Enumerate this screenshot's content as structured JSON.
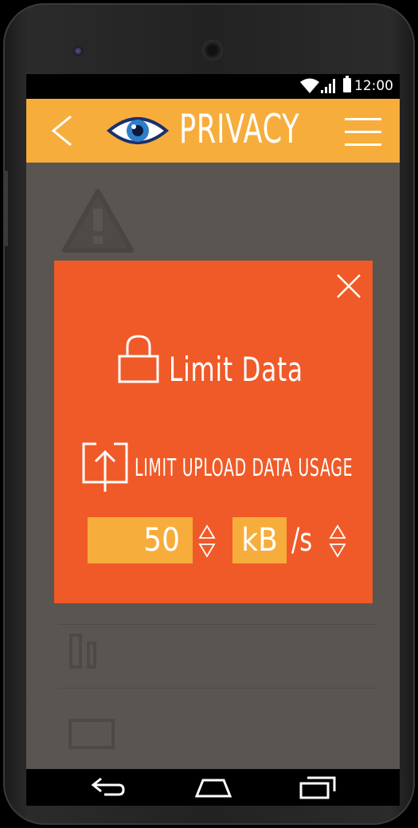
{
  "status_bar": {
    "time": "12:00",
    "icons": [
      "wifi-icon",
      "signal-icon",
      "battery-icon"
    ]
  },
  "app_bar": {
    "title": "PRIVACY",
    "icons": [
      "back-arrow-icon",
      "eye-icon",
      "hamburger-menu-icon"
    ]
  },
  "modal": {
    "title": "Limit Data",
    "title_icon": "lock-icon",
    "setting_label": "LIMIT UPLOAD DATA USAGE",
    "setting_icon": "upload-icon",
    "value": "50",
    "unit": "kB",
    "per": "/s",
    "close_icon": "close-icon"
  },
  "nav_bar": {
    "icons": [
      "back-icon",
      "home-icon",
      "recent-apps-icon"
    ]
  },
  "colors": {
    "accent": "#f7ad3c",
    "modal_bg": "#f05a28",
    "dim_bg": "#5a5551",
    "text": "#ffffff"
  }
}
